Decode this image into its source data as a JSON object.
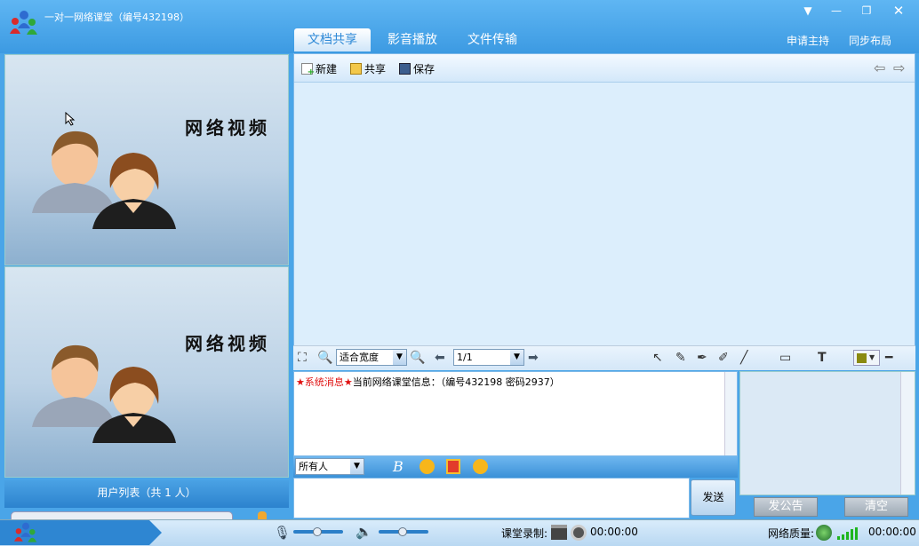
{
  "window": {
    "title": "一对一网络课堂（编号432198）"
  },
  "tabs": [
    {
      "label": "文档共享",
      "active": true
    },
    {
      "label": "影音播放",
      "active": false
    },
    {
      "label": "文件传输",
      "active": false
    }
  ],
  "header_links": {
    "apply_host": "申请主持",
    "sync_layout": "同步布局"
  },
  "video": {
    "panel1_text": "网络视频",
    "panel2_text": "网络视频"
  },
  "user_list": {
    "label": "用户列表（共 1 人）"
  },
  "doc_toolbar": {
    "new": "新建",
    "share": "共享",
    "save": "保存"
  },
  "bottom_tools": {
    "fit_option": "适合宽度",
    "page": "1/1"
  },
  "chat": {
    "system_label": "★系统消息★",
    "message": "当前网络课堂信息：（编号432198 密码2937）",
    "recipient": "所有人",
    "send": "发送"
  },
  "right_panel": {
    "post_notice": "发公告",
    "clear": "清空"
  },
  "status": {
    "record_label": "课堂录制:",
    "record_time": "00:00:00",
    "quality_label": "网络质量:",
    "quality_time": "00:00:00"
  },
  "colors": {
    "accent": "#3c9ae2",
    "system_red": "#e01010"
  }
}
